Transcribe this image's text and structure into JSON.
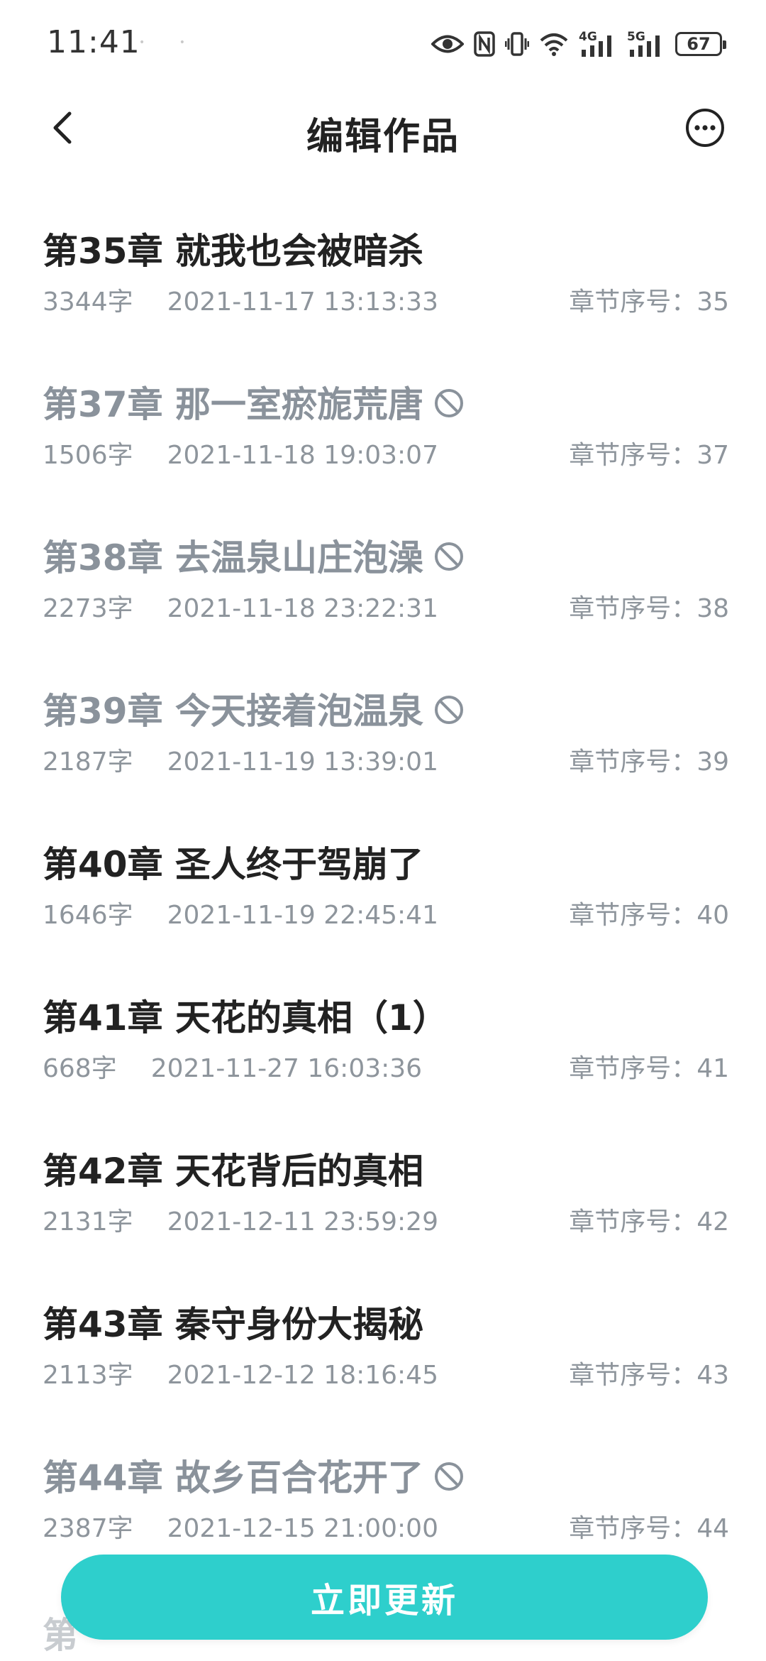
{
  "status_bar": {
    "time": "11:41",
    "network_1": "4G",
    "network_2": "5G",
    "battery": "67"
  },
  "header": {
    "title": "编辑作品"
  },
  "chapters": [
    {
      "title": "第35章 就我也会被暗杀",
      "words": "3344字",
      "time": "2021-11-17 13:13:33",
      "seq": "章节序号：35",
      "disabled": false
    },
    {
      "title": "第37章 那一室瘀旎荒唐",
      "words": "1506字",
      "time": "2021-11-18 19:03:07",
      "seq": "章节序号：37",
      "disabled": true
    },
    {
      "title": "第38章 去温泉山庄泡澡",
      "words": "2273字",
      "time": "2021-11-18 23:22:31",
      "seq": "章节序号：38",
      "disabled": true
    },
    {
      "title": "第39章 今天接着泡温泉",
      "words": "2187字",
      "time": "2021-11-19 13:39:01",
      "seq": "章节序号：39",
      "disabled": true
    },
    {
      "title": "第40章 圣人终于驾崩了",
      "words": "1646字",
      "time": "2021-11-19 22:45:41",
      "seq": "章节序号：40",
      "disabled": false
    },
    {
      "title": "第41章 天花的真相（1）",
      "words": "668字",
      "time": "2021-11-27 16:03:36",
      "seq": "章节序号：41",
      "disabled": false
    },
    {
      "title": "第42章 天花背后的真相",
      "words": "2131字",
      "time": "2021-12-11 23:59:29",
      "seq": "章节序号：42",
      "disabled": false
    },
    {
      "title": "第43章 秦守身份大揭秘",
      "words": "2113字",
      "time": "2021-12-12 18:16:45",
      "seq": "章节序号：43",
      "disabled": false
    },
    {
      "title": "第44章 故乡百合花开了",
      "words": "2387字",
      "time": "2021-12-15 21:00:00",
      "seq": "章节序号：44",
      "disabled": true
    }
  ],
  "partial_title": "第",
  "update_button": {
    "label": "立即更新",
    "color": "#2ecfcc"
  },
  "icons": {
    "back": "back-arrow-icon",
    "more": "more-options-icon",
    "disabled": "ban-icon"
  }
}
